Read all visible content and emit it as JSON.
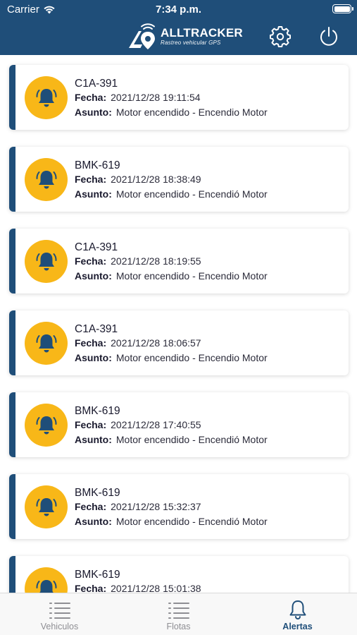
{
  "status_bar": {
    "carrier": "Carrier",
    "time": "7:34 p.m."
  },
  "header": {
    "brand_name": "ALLTRACKER",
    "brand_tagline": "Rastreo vehicular GPS",
    "settings_icon": "gear-icon",
    "logout_icon": "power-icon"
  },
  "labels": {
    "fecha": "Fecha:",
    "asunto": "Asunto:"
  },
  "alerts": [
    {
      "plate": "C1A-391",
      "fecha": "2021/12/28 19:11:54",
      "asunto": "Motor encendido - Encendio Motor"
    },
    {
      "plate": "BMK-619",
      "fecha": "2021/12/28 18:38:49",
      "asunto": "Motor encendido - Encendió Motor"
    },
    {
      "plate": "C1A-391",
      "fecha": "2021/12/28 18:19:55",
      "asunto": "Motor encendido - Encendio Motor"
    },
    {
      "plate": "C1A-391",
      "fecha": "2021/12/28 18:06:57",
      "asunto": "Motor encendido - Encendio Motor"
    },
    {
      "plate": "BMK-619",
      "fecha": "2021/12/28 17:40:55",
      "asunto": "Motor encendido - Encendió Motor"
    },
    {
      "plate": "BMK-619",
      "fecha": "2021/12/28 15:32:37",
      "asunto": "Motor encendido - Encendió Motor"
    },
    {
      "plate": "BMK-619",
      "fecha": "2021/12/28 15:01:38",
      "asunto": ""
    }
  ],
  "tabs": [
    {
      "label": "Vehiculos",
      "icon": "list-icon",
      "active": false
    },
    {
      "label": "Flotas",
      "icon": "list-icon",
      "active": false
    },
    {
      "label": "Alertas",
      "icon": "bell-icon",
      "active": true
    }
  ],
  "colors": {
    "primary": "#1f4e79",
    "alert_icon_bg": "#f8b718",
    "inactive_tab": "#8e8e93"
  }
}
